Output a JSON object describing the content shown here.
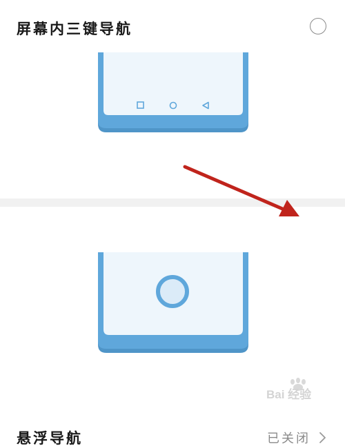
{
  "sections": {
    "three_key": {
      "title": "屏幕内三键导航",
      "selected": false
    },
    "floating": {
      "title": "悬浮导航",
      "status": "已关闭"
    }
  },
  "icons": {
    "nav_recent": "square-icon",
    "nav_home": "circle-icon",
    "nav_back": "triangle-back-icon",
    "floating_button": "floating-nav-ball-icon",
    "status_chevron": "chevron-right-icon"
  },
  "colors": {
    "phone_frame": "#5fa7db",
    "phone_screen": "#eef6fc",
    "annotation_arrow": "#c0241c",
    "divider": "#f1f1f1",
    "status_text": "#8a8a8a"
  },
  "watermark": {
    "text": "Bai 经验"
  }
}
